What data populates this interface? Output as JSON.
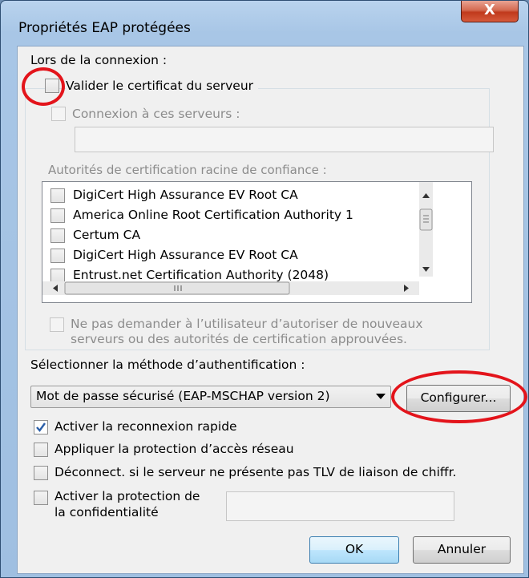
{
  "window": {
    "title": "Propriétés EAP protégées",
    "close_glyph": "X"
  },
  "connection": {
    "label": "Lors de la connexion :",
    "validate_cert": "Valider le certificat du serveur",
    "connect_servers": "Connexion à ces serveurs :",
    "servers_value": "",
    "trusted_roots_label": "Autorités de certification racine de confiance :",
    "cert_list": [
      "DigiCert High Assurance EV Root CA",
      "America Online Root Certification Authority 1",
      "Certum CA",
      "DigiCert High Assurance EV Root CA",
      "Entrust.net Certification Authority (2048)"
    ],
    "no_prompt_line1": "Ne pas demander à l’utilisateur d’autoriser de nouveaux",
    "no_prompt_line2": "serveurs ou des autorités de certification approuvées."
  },
  "auth": {
    "label": "Sélectionner la méthode d’authentification :",
    "method": "Mot de passe sécurisé (EAP-MSCHAP version 2)",
    "configure": "Configurer..."
  },
  "options": {
    "fast_reconnect": "Activer la reconnexion rapide",
    "fast_reconnect_checked": true,
    "nap": "Appliquer la protection d’accès réseau",
    "disconnect_tlv": "Déconnect. si le serveur ne présente pas TLV de liaison de chiffr.",
    "privacy_line1": "Activer la protection de",
    "privacy_line2": "la confidentialité",
    "privacy_value": ""
  },
  "buttons": {
    "ok": "OK",
    "cancel": "Annuler"
  },
  "colors": {
    "highlight_ring": "#e3141b",
    "check": "#2a5ea8"
  }
}
